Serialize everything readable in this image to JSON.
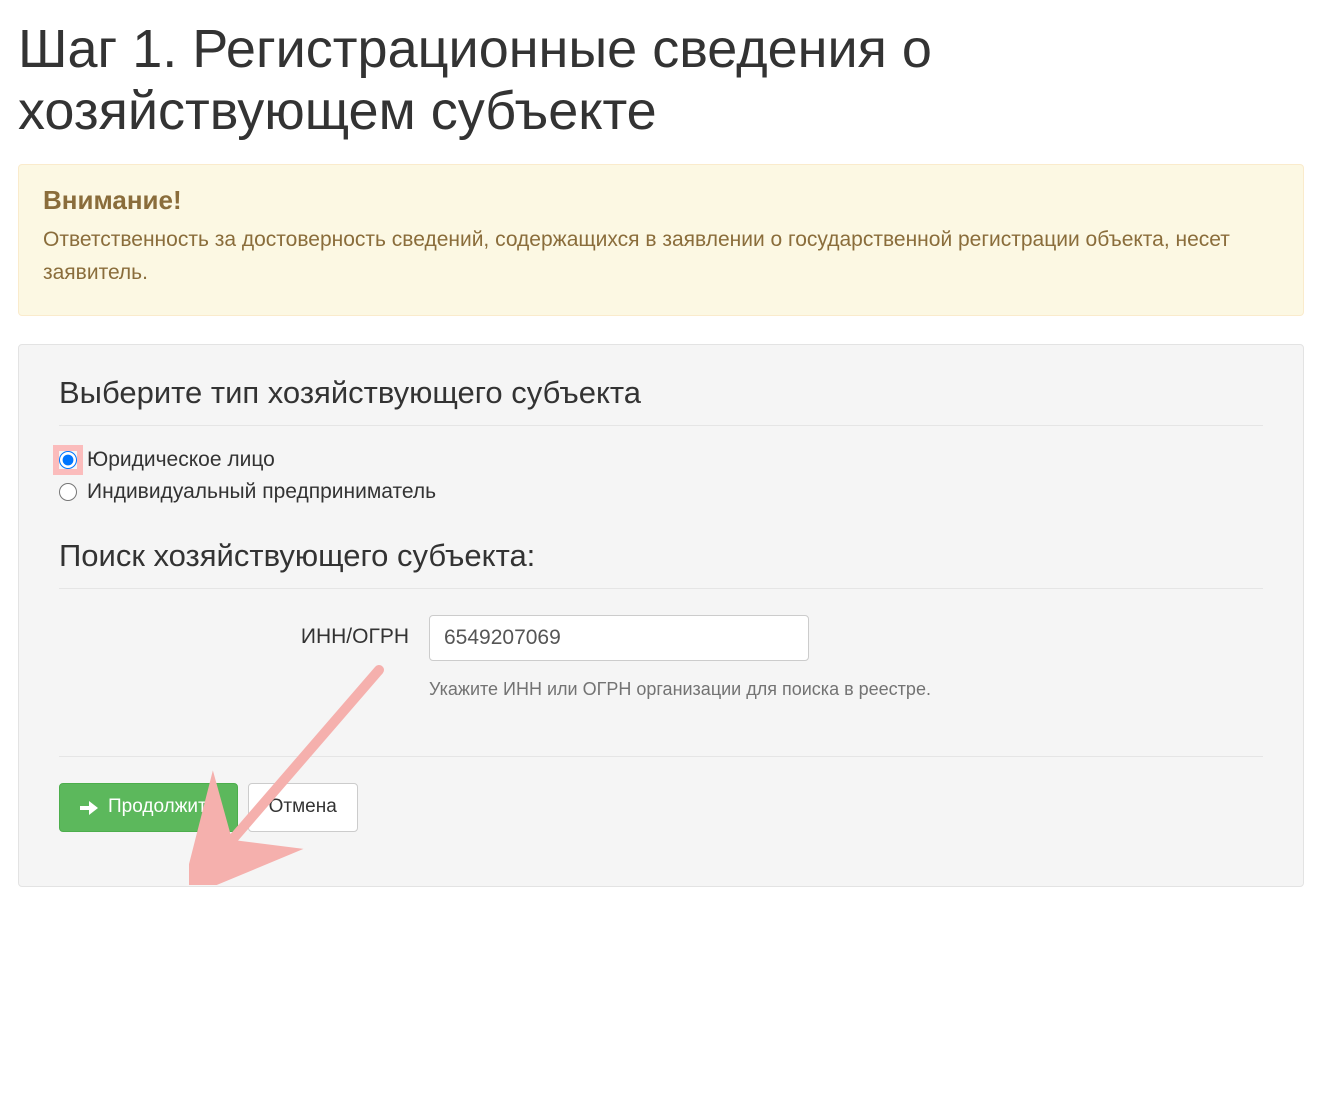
{
  "header": {
    "title": "Шаг 1. Регистрационные сведения о хозяйствующем субъекте"
  },
  "alert": {
    "heading": "Внимание!",
    "body": "Ответственность за достоверность сведений, содержащихся в заявлении о государственной регистрации объекта, несет заявитель."
  },
  "panel": {
    "type_heading": "Выберите тип хозяйствующего субъекта",
    "entity_types": [
      {
        "label": "Юридическое лицо",
        "selected": true
      },
      {
        "label": "Индивидуальный предприниматель",
        "selected": false
      }
    ],
    "search_heading": "Поиск хозяйствующего субъекта:",
    "inn": {
      "label": "ИНН/ОГРН",
      "value": "6549207069",
      "help": "Укажите ИНН или ОГРН организации для поиска в реестре."
    },
    "actions": {
      "continue": "Продолжить",
      "cancel": "Отмена"
    }
  },
  "colors": {
    "accent_green": "#5cb85c",
    "alert_bg": "#fcf8e3",
    "alert_text": "#8a6d3b",
    "annotation_arrow": "#f5b0ad"
  }
}
